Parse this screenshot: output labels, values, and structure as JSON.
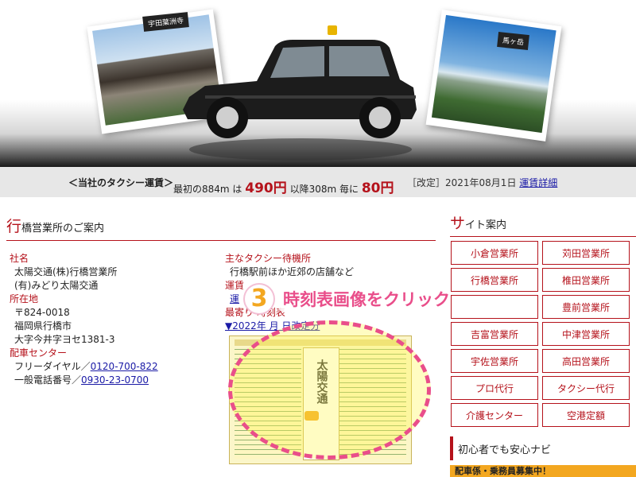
{
  "hero": {
    "photo_left_tag": "宇田葉洲寺",
    "photo_right_tag": "馬ヶ岳",
    "car_alt": "taxi"
  },
  "fare": {
    "title": "＜当社のタクシー運賃＞",
    "first_prefix": "最初の884m は",
    "first_price": "490円",
    "then_prefix": "以降308m 毎に",
    "then_price": "80円",
    "revision": "［改定］2021年08月1日",
    "detail_link": "運賃詳細"
  },
  "office": {
    "heading_first": "行",
    "heading_rest": "橋営業所のご案内",
    "company_label": "社名",
    "company_line1": "太陽交通(株)行橋営業所",
    "company_line2": "(有)みどり太陽交通",
    "address_label": "所在地",
    "postal": "〒824-0018",
    "address_line1": "福岡県行橋市",
    "address_line2": "大字今井字ヨセ1381-3",
    "dispatch_label": "配車センター",
    "freedial_prefix": "フリーダイヤル／",
    "freedial": "0120-700-822",
    "phone_prefix": "一般電話番号／",
    "phone": "0930-23-0700",
    "standby_label": "主なタクシー待機所",
    "standby_value": "行橋駅前ほか近郊の店舗など",
    "fare_label": "運賃",
    "fare_link": "運",
    "timetable_label": "最寄り       時刻表",
    "timetable_link": "▼2022年  月  日改定分"
  },
  "callout": {
    "number": "3",
    "text": "時刻表画像をクリック"
  },
  "timetable_image": {
    "logo": "太陽交通"
  },
  "sidebar": {
    "heading_first": "サ",
    "heading_rest": "イト案内",
    "offices": [
      "小倉営業所",
      "苅田営業所",
      "行橋営業所",
      "椎田営業所",
      "",
      "豊前営業所",
      "吉富営業所",
      "中津営業所",
      "宇佐営業所",
      "高田営業所",
      "プロ代行",
      "タクシー代行",
      "介護センター",
      "空港定額"
    ],
    "navi": "初心者でも安心ナビ",
    "banner": "配車係・乗務員募集中！"
  }
}
